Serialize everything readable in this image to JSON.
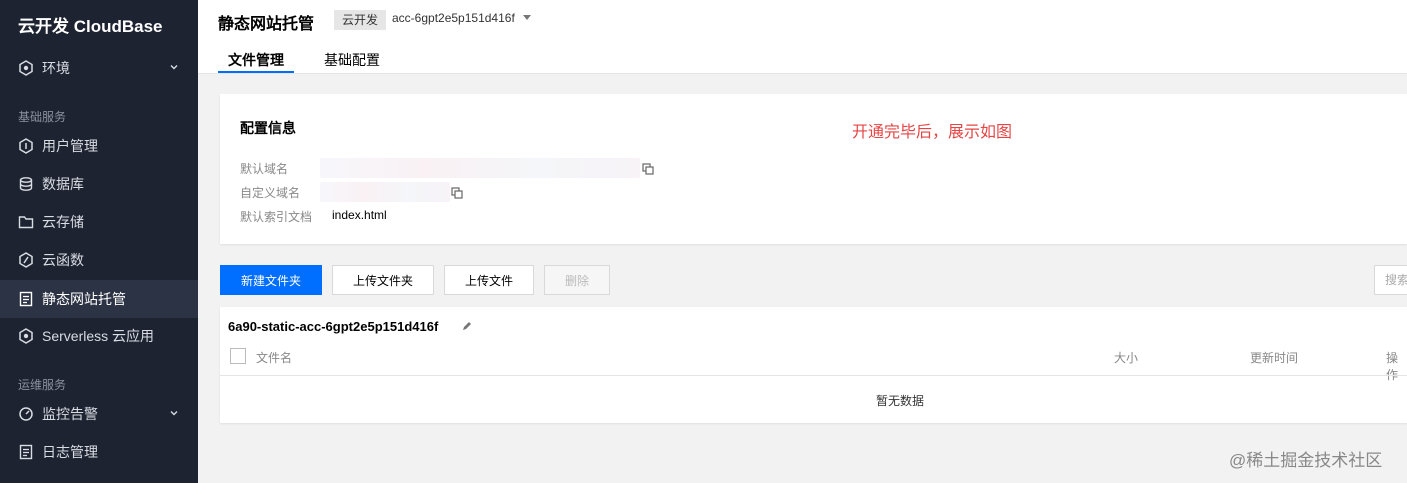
{
  "sidebar": {
    "brand": "云开发 CloudBase",
    "env_item": "环境",
    "section_basic": "基础服务",
    "items_basic": [
      {
        "label": "用户管理",
        "icon": "user-manage-icon"
      },
      {
        "label": "数据库",
        "icon": "database-icon"
      },
      {
        "label": "云存储",
        "icon": "folder-icon"
      },
      {
        "label": "云函数",
        "icon": "function-icon"
      },
      {
        "label": "静态网站托管",
        "icon": "static-site-icon"
      },
      {
        "label": "Serverless 云应用",
        "icon": "serverless-icon"
      }
    ],
    "section_ops": "运维服务",
    "items_ops": [
      {
        "label": "监控告警",
        "icon": "monitor-icon"
      },
      {
        "label": "日志管理",
        "icon": "log-icon"
      }
    ],
    "active_item": "静态网站托管"
  },
  "header": {
    "title": "静态网站托管",
    "env_tag": "云开发",
    "env_id": "acc-6gpt2e5p151d416f",
    "tabs": [
      "文件管理",
      "基础配置"
    ],
    "active_tab": "文件管理"
  },
  "config": {
    "title": "配置信息",
    "annotation": "开通完毕后，展示如图",
    "default_domain_label": "默认域名",
    "custom_domain_label": "自定义域名",
    "index_doc_label": "默认索引文档",
    "index_doc_value": "index.html"
  },
  "toolbar": {
    "new_folder": "新建文件夹",
    "upload_folder": "上传文件夹",
    "upload_file": "上传文件",
    "delete": "删除",
    "search_placeholder": "搜索"
  },
  "files": {
    "bucket_name": "6a90-static-acc-6gpt2e5p151d416f",
    "columns": {
      "name": "文件名",
      "size": "大小",
      "updated": "更新时间",
      "ops": "操作"
    },
    "empty_text": "暂无数据"
  },
  "watermark": "@稀土掘金技术社区",
  "colors": {
    "sidebar_bg": "#1d2331",
    "primary": "#006eff",
    "annotation": "#e54545"
  }
}
